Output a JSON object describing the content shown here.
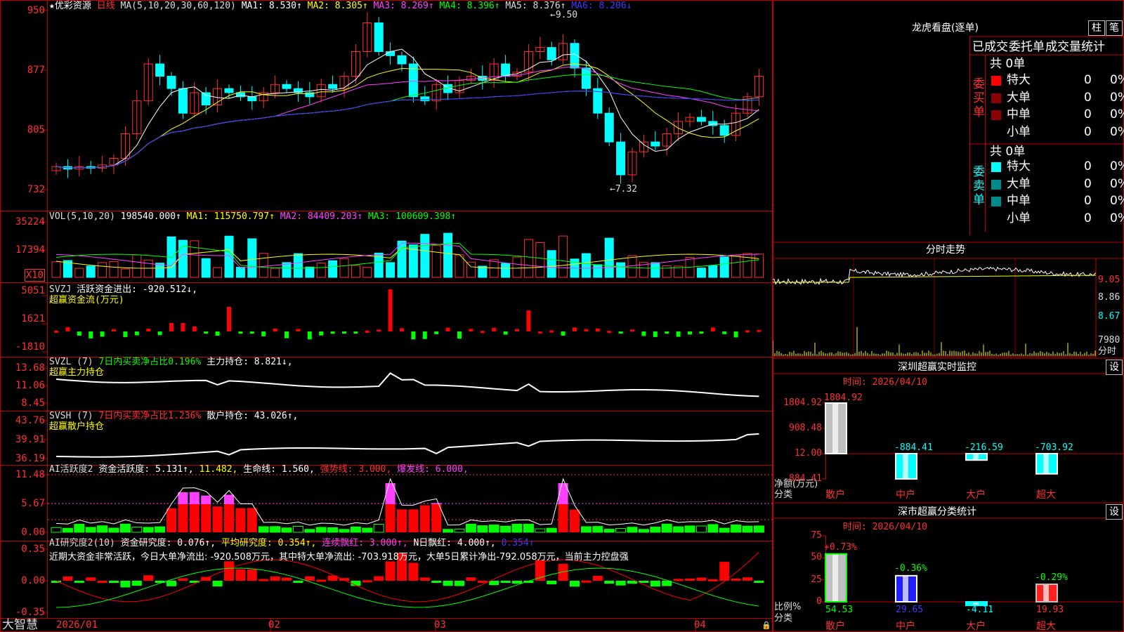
{
  "kline": {
    "stock_name": "★优彩资源",
    "period": "日线",
    "ma_prefix": "MA(5,10,20,30,60,120)",
    "ma": [
      "MA1: 8.530↑",
      "MA2: 8.305↑",
      "MA3: 8.269↑",
      "MA4: 8.396↑",
      "MA5: 8.376↑",
      "MA6: 8.206↓"
    ],
    "y_labels": [
      "950",
      "877",
      "805",
      "732"
    ],
    "high_mark": "9.50",
    "low_mark": "7.32"
  },
  "vol": {
    "title": "VOL(5,10,20)",
    "value": "198540.000↑",
    "ma": [
      "MA1: 115750.797↑",
      "MA2: 84409.203↑",
      "MA3: 100609.398↑"
    ],
    "y_labels": [
      "35224",
      "17394"
    ],
    "unit": "X10"
  },
  "svzj": {
    "title": "SVZJ",
    "line": "活跃资金进出: -920.512↓,",
    "sub": "超赢资金流(万元)",
    "y_labels": [
      "5051",
      "1621",
      "-1810"
    ]
  },
  "svzl": {
    "title": "SVZL (7)",
    "line1": "7日内买卖净占比0.196%",
    "line2": "主力持仓: 8.821↓,",
    "sub": "超赢主力持仓",
    "y_labels": [
      "13.68",
      "11.06",
      "8.45"
    ]
  },
  "svsh": {
    "title": "SVSH (7)",
    "line1": "7日内买卖净占比1.236%",
    "line2": "散户持仓: 43.026↑,",
    "sub": "超赢散户持仓",
    "y_labels": [
      "43.76",
      "39.91",
      "36.19"
    ]
  },
  "ai1": {
    "title": "AI活跃度2",
    "p1": "资金活跃度: 5.131↑,",
    "p2": "11.482,",
    "p3": "生命线: 1.560,",
    "p4": "强势线: 3.000,",
    "p5": "爆发线: 6.000,",
    "y_labels": [
      "11.48",
      "5.67",
      "0.00"
    ]
  },
  "ai2": {
    "title": "AI研究度2(10)",
    "p1": "资金研究度: 0.076↑,",
    "p2": "平均研究度: 0.354↑,",
    "p3": "连续飘红: 3.000↑,",
    "p4": "N日飘红: 4.000↑,",
    "p5": "0.354↑",
    "comment": "近期大资金非常活跃，今日大单净流出: -920.508万元，其中特大单净流出: -703.918万元，大单5日累计净出-792.058万元，当前主力控盘强",
    "y_labels": [
      "0.35",
      "0.00",
      "-0.35"
    ]
  },
  "xaxis": {
    "brand": "大智慧",
    "labels": [
      "2026/01",
      "02",
      "03",
      "04"
    ]
  },
  "longhu": {
    "title": "龙虎看盘(逐单)",
    "btn_bar": "柱",
    "btn_pen": "笔",
    "tabs": [
      "已成交",
      "委托单",
      "成交量统计"
    ],
    "buy_side": "委买单",
    "sell_side": "委卖单",
    "buy_total": "共 0单",
    "sell_total": "共 0单",
    "rows": [
      "特大",
      "大单",
      "中单",
      "小单"
    ],
    "count": "0",
    "pct": "0%",
    "colors_buy": [
      "#ff0000",
      "#8b0000",
      "#8b0000",
      "#000000"
    ],
    "colors_sell": [
      "#00ffff",
      "#008b8b",
      "#008b8b",
      "#000000"
    ]
  },
  "fenshi": {
    "title": "分时走势",
    "y_labels": [
      "9.05",
      "8.86",
      "8.67"
    ],
    "vol_label": "7980",
    "vol_unit": "分时"
  },
  "sz_monitor": {
    "title": "深圳超赢实时监控",
    "setting": "设",
    "time": "时间: 2026/04/10",
    "y_labels": [
      "1804.92",
      "908.48",
      "12.00",
      "-884.41"
    ],
    "axis_name": "净额(万元)",
    "axis_sub": "分类",
    "chart_data": {
      "type": "bar",
      "categories": [
        "散户",
        "中户",
        "大户",
        "超大"
      ],
      "values": [
        1804.92,
        -884.41,
        -216.59,
        -703.92
      ],
      "ylim": [
        -884.41,
        1804.92
      ]
    }
  },
  "sz_class": {
    "title": "深市超赢分类统计",
    "setting": "设",
    "time": "时间: 2026/04/10",
    "y_labels": [
      "75",
      "50",
      "25",
      "0"
    ],
    "axis_name": "比例%",
    "axis_sub": "分类",
    "chart_data": {
      "type": "bar",
      "categories": [
        "散户",
        "中户",
        "大户",
        "超大"
      ],
      "values": [
        54.53,
        29.65,
        -4.11,
        19.93
      ],
      "changes": [
        "+0.73%",
        "-0.36%",
        "",
        "-0.29%"
      ],
      "ylim": [
        0,
        75
      ]
    }
  }
}
